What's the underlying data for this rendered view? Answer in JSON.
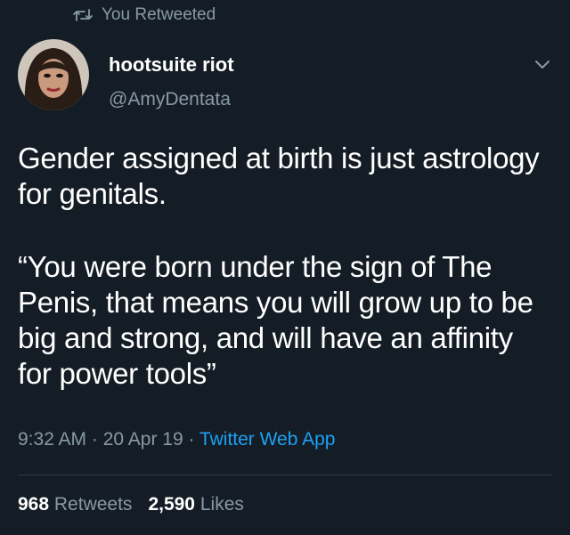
{
  "retweet": {
    "icon": "retweet-icon",
    "label": "You Retweeted"
  },
  "author": {
    "avatar": "avatar",
    "display_name": "hootsuite riot",
    "handle": "@AmyDentata"
  },
  "menu": {
    "icon": "chevron-down-icon"
  },
  "tweet": {
    "paragraphs": [
      "Gender assigned at birth is just astrology for genitals.",
      "“You were born under the sign of The Penis, that means you will grow up to be big and strong, and will have an affinity for power tools”"
    ]
  },
  "meta": {
    "time": "9:32 AM",
    "separator": " · ",
    "date": "20 Apr 19",
    "source": "Twitter Web App"
  },
  "stats": {
    "retweets_count": "968",
    "retweets_label": "Retweets",
    "likes_count": "2,590",
    "likes_label": "Likes"
  },
  "colors": {
    "background": "#141d26",
    "text": "#ffffff",
    "muted": "#8899a6",
    "link": "#1da1f2",
    "divider": "#2b3947"
  }
}
